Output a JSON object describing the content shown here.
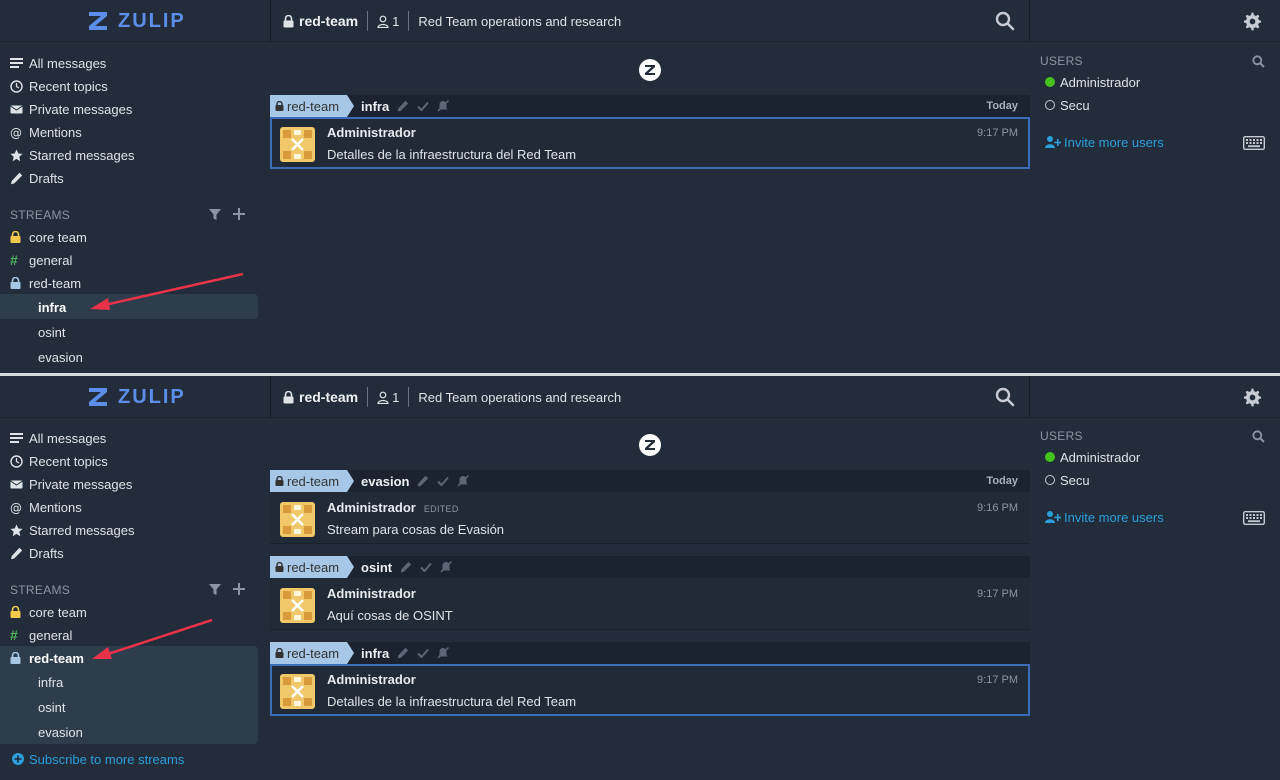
{
  "app": {
    "name": "ZULIP"
  },
  "colors": {
    "accent": "#5c8eea",
    "link": "#2d9fdb",
    "stream_label": "#a6c7e6",
    "active_dot": "#44c21d",
    "arrow": "#e8324a",
    "core_team_lock": "#f1c94c",
    "general_hash": "#4fb35f",
    "red_team_lock": "#a6c7e6"
  },
  "header": {
    "stream": "red-team",
    "subscribers": "1",
    "description": "Red Team operations and research"
  },
  "nav": {
    "all_messages": "All messages",
    "recent_topics": "Recent topics",
    "private_messages": "Private messages",
    "mentions": "Mentions",
    "starred_messages": "Starred messages",
    "drafts": "Drafts"
  },
  "streams": {
    "header": "STREAMS",
    "core_team": "core team",
    "general": "general",
    "red_team": "red-team",
    "topics": {
      "infra": "infra",
      "osint": "osint",
      "evasion": "evasion"
    },
    "subscribe_more": "Subscribe to more streams"
  },
  "users": {
    "header": "USERS",
    "list": [
      {
        "name": "Administrador",
        "status": "active"
      },
      {
        "name": "Secu",
        "status": "idle"
      }
    ],
    "invite": "Invite more users"
  },
  "messages": {
    "today": "Today",
    "evasion": {
      "stream": "red-team",
      "topic": "evasion",
      "sender": "Administrador",
      "edited": "EDITED",
      "time": "9:16 PM",
      "content": "Stream para cosas de Evasión"
    },
    "osint": {
      "stream": "red-team",
      "topic": "osint",
      "sender": "Administrador",
      "time": "9:17 PM",
      "content": "Aquí cosas de OSINT"
    },
    "infra": {
      "stream": "red-team",
      "topic": "infra",
      "sender": "Administrador",
      "time": "9:17 PM",
      "content": "Detalles de la infraestructura del Red Team"
    }
  }
}
